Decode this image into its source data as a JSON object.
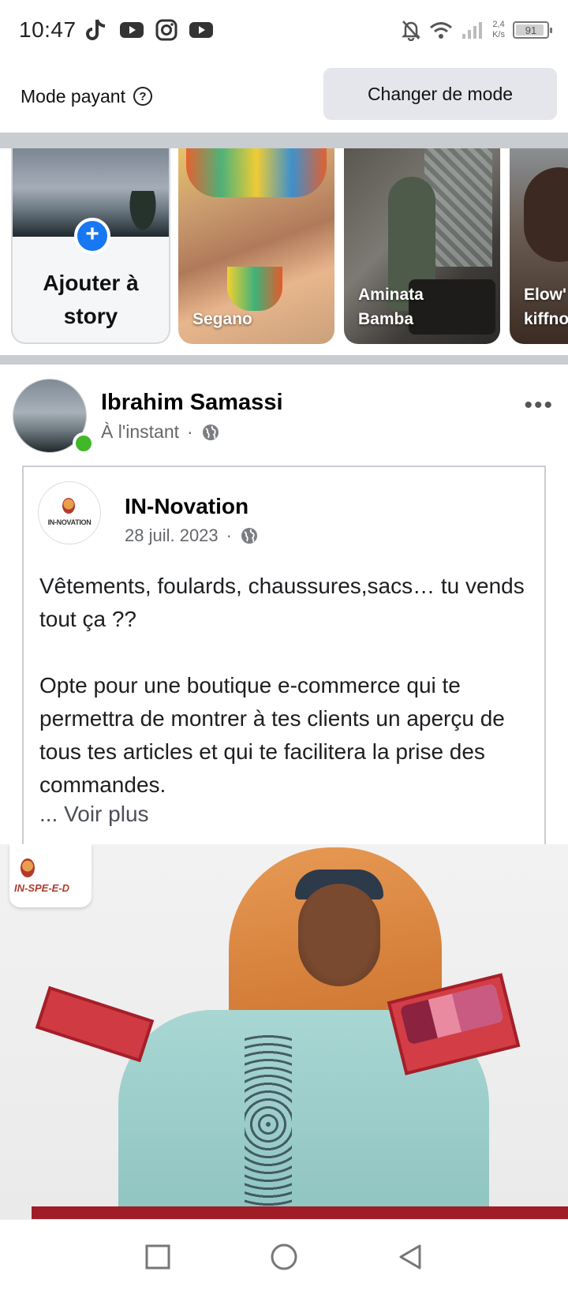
{
  "status_bar": {
    "time": "10:47",
    "app_icons": [
      "tiktok-icon",
      "youtube-icon",
      "instagram-icon",
      "youtube-icon"
    ],
    "net_speed_value": "2,4",
    "net_speed_unit": "K/s",
    "battery": "91",
    "battery_level": 0.91
  },
  "mode_bar": {
    "label": "Mode payant",
    "help_icon": "?",
    "button_label": "Changer de mode"
  },
  "stories": [
    {
      "type": "create",
      "label_line1": "Ajouter à",
      "label_line2": "story",
      "plus": "+"
    },
    {
      "name_line1": "Segano",
      "name_line2": ""
    },
    {
      "name_line1": "Aminata",
      "name_line2": "Bamba"
    },
    {
      "name_line1": "Elow'",
      "name_line2": "kiffno"
    }
  ],
  "post": {
    "author": "Ibrahim Samassi",
    "time": "À l'instant",
    "separator": "·",
    "more": "•••",
    "shared": {
      "page_name": "IN-Novation",
      "logo_text": "IN-NOVATION",
      "date": "28 juil. 2023",
      "separator": "·",
      "text_p1": "Vêtements, foulards, chaussures,sacs… tu vends tout ça ??",
      "text_p2": "Opte pour une boutique e-commerce qui te permettra de montrer à tes clients un aperçu de tous tes articles et qui te facilitera la prise des commandes.",
      "see_more": "... Voir plus"
    },
    "image": {
      "logo_text": "IN-SPE-E-D"
    }
  },
  "colors": {
    "accent": "#1877f2",
    "online": "#42b72a",
    "divider": "#c9ccd1",
    "button_bg": "#e4e6eb"
  }
}
